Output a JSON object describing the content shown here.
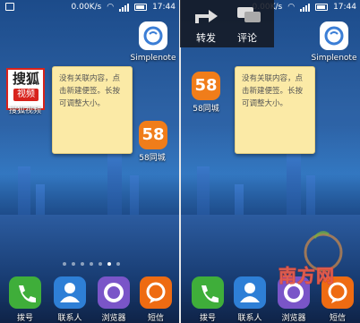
{
  "left": {
    "status": {
      "speed": "0.00K/s",
      "time": "17:44"
    },
    "apps": {
      "sohu": {
        "label": "搜狐视频",
        "logo_top": "搜狐",
        "logo_bottom": "视频"
      },
      "simplenote": {
        "label": "Simplenote"
      },
      "app58": {
        "label": "58同城",
        "logo": "58"
      }
    },
    "note": {
      "text": "没有关联内容，点击新建便签。长按可调整大小。"
    },
    "dock": {
      "phone": "拨号",
      "contacts": "联系人",
      "browser": "浏览器",
      "sms": "短信"
    }
  },
  "right": {
    "status": {
      "speed": "0.00K/s",
      "time": "17:44"
    },
    "share": {
      "forward": "转发",
      "comment": "评论"
    },
    "apps": {
      "simplenote": {
        "label": "Simplenote"
      },
      "app58": {
        "label": "58同城",
        "logo": "58"
      }
    },
    "note": {
      "text": "没有关联内容，点击新建便签。长按可调整大小。"
    },
    "dock": {
      "phone": "拨号",
      "contacts": "联系人",
      "browser": "浏览器",
      "sms": "短信"
    }
  },
  "watermark": {
    "text": "南方网"
  },
  "colors": {
    "note": "#fbeaa6",
    "orange58": "#f07d1a",
    "sohu_red": "#d8231c",
    "phone_green": "#3fae3a",
    "contacts_blue": "#2e7fd6",
    "browser_purple": "#7a55c8",
    "sms_orange": "#ee6b12"
  }
}
